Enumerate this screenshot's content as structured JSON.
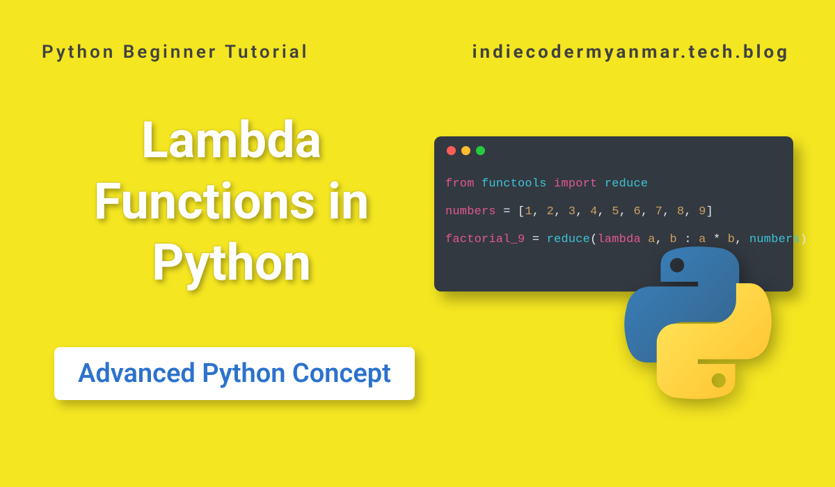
{
  "header": {
    "category": "Python Beginner Tutorial",
    "site": "indiecodermyanmar.tech.blog"
  },
  "title": "Lambda Functions in Python",
  "badge": {
    "label": "Advanced Python Concept"
  },
  "code": {
    "line1": {
      "from": "from",
      "module": "functools",
      "import": "import",
      "name": "reduce"
    },
    "line2": {
      "var": "numbers",
      "eq": " = ",
      "lbrack": "[",
      "n1": "1",
      "n2": "2",
      "n3": "3",
      "n4": "4",
      "n5": "5",
      "n6": "6",
      "n7": "7",
      "n8": "8",
      "n9": "9",
      "rbrack": "]",
      "comma": ", "
    },
    "line3": {
      "var": "factorial_9",
      "eq": " = ",
      "fn": "reduce",
      "lparen": "(",
      "lambda": "lambda",
      "a": "a",
      "comma": ", ",
      "b": "b",
      "colon": " : ",
      "a2": "a",
      "star": " * ",
      "b2": "b",
      "comma2": ", ",
      "arg2": "numbers",
      "rparen": ")"
    }
  }
}
